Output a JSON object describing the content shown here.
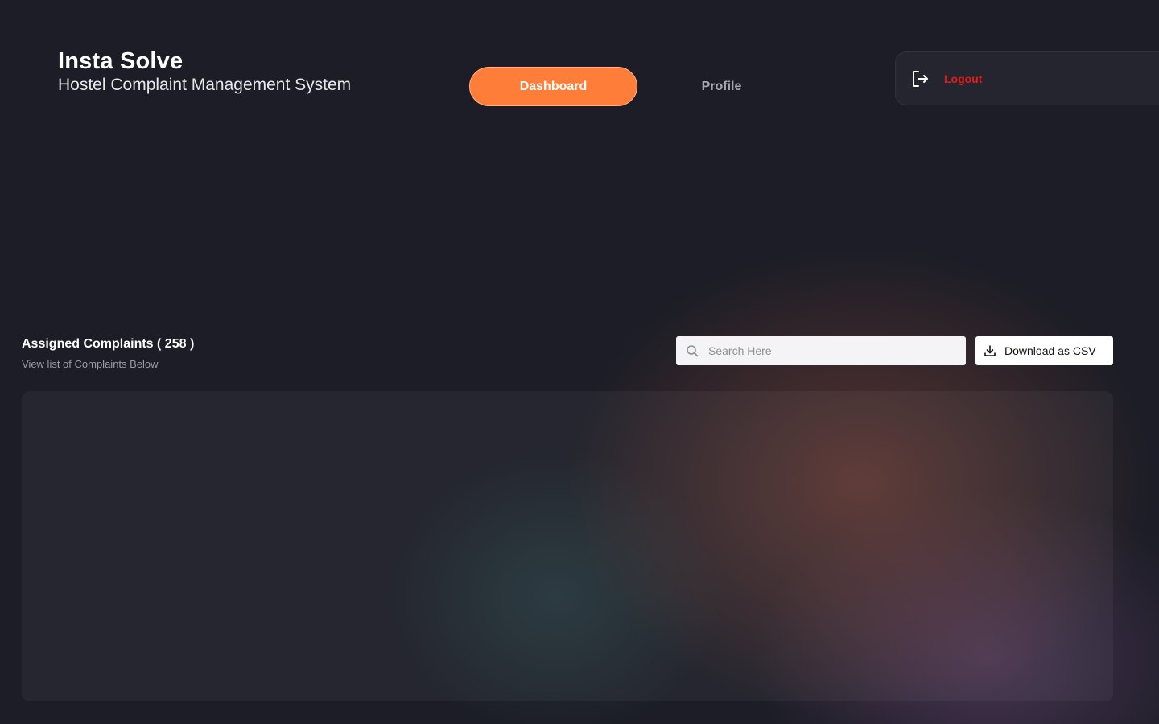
{
  "header": {
    "title": "Insta Solve",
    "subtitle": "Hostel Complaint Management System"
  },
  "nav": {
    "tabs": [
      {
        "label": "Dashboard",
        "active": true
      },
      {
        "label": "Profile",
        "active": false
      }
    ]
  },
  "logout": {
    "label": "Logout",
    "icon": "logout-icon",
    "color": "#e31b1b"
  },
  "complaints": {
    "title": "Assigned Complaints ( 258 )",
    "subtitle": "View list of Complaints Below"
  },
  "search": {
    "placeholder": "Search Here",
    "value": "",
    "icon": "search-icon"
  },
  "download": {
    "label": "Download as CSV",
    "icon": "download-icon"
  },
  "colors": {
    "accent": "#fe7d39",
    "background": "#1c1d26",
    "danger": "#e31b1b"
  }
}
